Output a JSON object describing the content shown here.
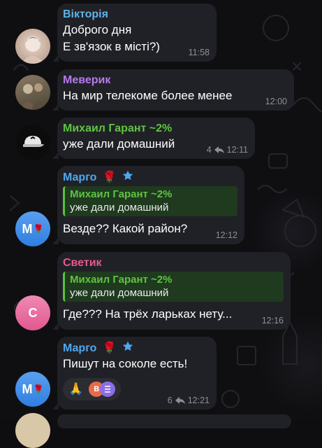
{
  "colors": {
    "bubble": "#202126",
    "name_viktoria": "#5fb3e8",
    "name_meverik": "#b57bee",
    "name_mikhail": "#5fc441",
    "name_margo": "#4fa8f0",
    "name_svetik": "#e8588f",
    "time": "#8e8f95"
  },
  "messages": [
    {
      "sender": "Вікторія",
      "lines": [
        "Доброго дня",
        "Е зв'язок в місті?)"
      ],
      "time": "11:58"
    },
    {
      "sender": "Меверик",
      "lines": [
        "На мир телекоме более менее"
      ],
      "time": "12:00"
    },
    {
      "sender": "Михаил Гарант ~2%",
      "lines": [
        "уже дали домашний"
      ],
      "time": "12:11",
      "reply_count": "4"
    },
    {
      "sender": "Марго",
      "avatar_initials": "М",
      "quote": {
        "name": "Михаил Гарант ~2%",
        "text": "уже дали домашний"
      },
      "lines": [
        "Везде?? Какой район?"
      ],
      "time": "12:12"
    },
    {
      "sender": "Светик",
      "avatar_initials": "С",
      "quote": {
        "name": "Михаил Гарант ~2%",
        "text": "уже дали домашний"
      },
      "lines": [
        "Где??? На трёх ларьках нету..."
      ],
      "time": "12:16"
    },
    {
      "sender": "Марго",
      "avatar_initials": "М",
      "lines": [
        "Пишут на соколе есть!"
      ],
      "reaction_emoji": "🙏",
      "reaction_avatars": [
        "В",
        ""
      ],
      "reply_count": "6",
      "time": "12:21"
    }
  ]
}
